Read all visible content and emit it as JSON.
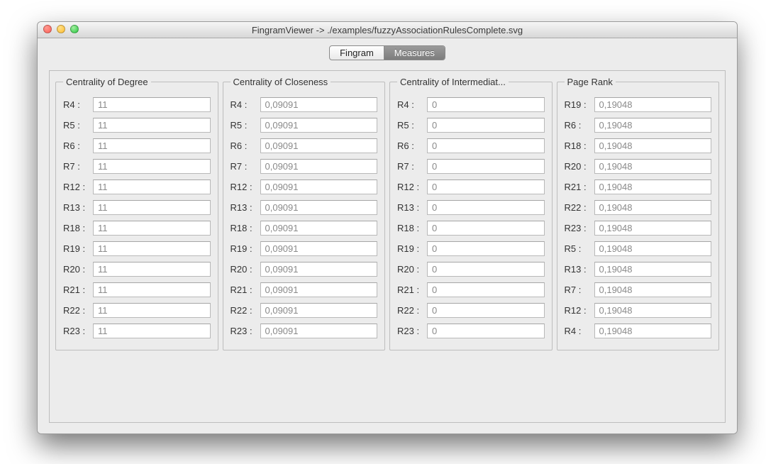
{
  "window": {
    "title": "FingramViewer -> ./examples/fuzzyAssociationRulesComplete.svg"
  },
  "tabs": {
    "fingram": "Fingram",
    "measures": "Measures",
    "active": "measures"
  },
  "groups": [
    {
      "title": "Centrality of Degree",
      "rows": [
        {
          "label": "R4 :",
          "value": "11"
        },
        {
          "label": "R5 :",
          "value": "11"
        },
        {
          "label": "R6 :",
          "value": "11"
        },
        {
          "label": "R7 :",
          "value": "11"
        },
        {
          "label": "R12 :",
          "value": "11"
        },
        {
          "label": "R13 :",
          "value": "11"
        },
        {
          "label": "R18 :",
          "value": "11"
        },
        {
          "label": "R19 :",
          "value": "11"
        },
        {
          "label": "R20 :",
          "value": "11"
        },
        {
          "label": "R21 :",
          "value": "11"
        },
        {
          "label": "R22 :",
          "value": "11"
        },
        {
          "label": "R23 :",
          "value": "11"
        }
      ]
    },
    {
      "title": "Centrality of Closeness",
      "rows": [
        {
          "label": "R4 :",
          "value": "0,09091"
        },
        {
          "label": "R5 :",
          "value": "0,09091"
        },
        {
          "label": "R6 :",
          "value": "0,09091"
        },
        {
          "label": "R7 :",
          "value": "0,09091"
        },
        {
          "label": "R12 :",
          "value": "0,09091"
        },
        {
          "label": "R13 :",
          "value": "0,09091"
        },
        {
          "label": "R18 :",
          "value": "0,09091"
        },
        {
          "label": "R19 :",
          "value": "0,09091"
        },
        {
          "label": "R20 :",
          "value": "0,09091"
        },
        {
          "label": "R21 :",
          "value": "0,09091"
        },
        {
          "label": "R22 :",
          "value": "0,09091"
        },
        {
          "label": "R23 :",
          "value": "0,09091"
        }
      ]
    },
    {
      "title": "Centrality of Intermediat...",
      "rows": [
        {
          "label": "R4 :",
          "value": "0"
        },
        {
          "label": "R5 :",
          "value": "0"
        },
        {
          "label": "R6 :",
          "value": "0"
        },
        {
          "label": "R7 :",
          "value": "0"
        },
        {
          "label": "R12 :",
          "value": "0"
        },
        {
          "label": "R13 :",
          "value": "0"
        },
        {
          "label": "R18 :",
          "value": "0"
        },
        {
          "label": "R19 :",
          "value": "0"
        },
        {
          "label": "R20 :",
          "value": "0"
        },
        {
          "label": "R21 :",
          "value": "0"
        },
        {
          "label": "R22 :",
          "value": "0"
        },
        {
          "label": "R23 :",
          "value": "0"
        }
      ]
    },
    {
      "title": "Page Rank",
      "rows": [
        {
          "label": "R19 :",
          "value": "0,19048"
        },
        {
          "label": "R6 :",
          "value": "0,19048"
        },
        {
          "label": "R18 :",
          "value": "0,19048"
        },
        {
          "label": "R20 :",
          "value": "0,19048"
        },
        {
          "label": "R21 :",
          "value": "0,19048"
        },
        {
          "label": "R22 :",
          "value": "0,19048"
        },
        {
          "label": "R23 :",
          "value": "0,19048"
        },
        {
          "label": "R5 :",
          "value": "0,19048"
        },
        {
          "label": "R13 :",
          "value": "0,19048"
        },
        {
          "label": "R7 :",
          "value": "0,19048"
        },
        {
          "label": "R12 :",
          "value": "0,19048"
        },
        {
          "label": "R4 :",
          "value": "0,19048"
        }
      ]
    }
  ]
}
